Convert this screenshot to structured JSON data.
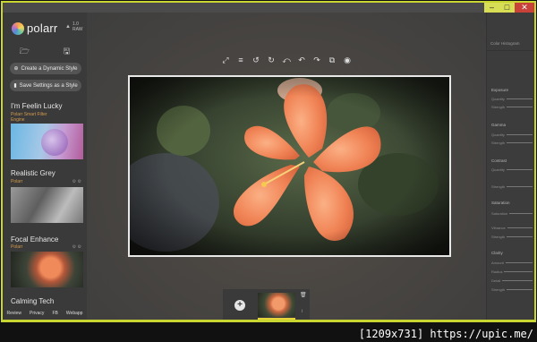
{
  "window": {
    "controls": {
      "minimize": "–",
      "maximize": "□",
      "close": "✕"
    }
  },
  "brand": {
    "name": "polarr",
    "version": "1.0 RAW"
  },
  "sidebar": {
    "file_icons": [
      "folder-open-icon",
      "save-icon"
    ],
    "create_style_label": "Create a Dynamic Style",
    "save_settings_label": "Save Settings as a Style",
    "styles": [
      {
        "title": "I'm Feelin Lucky",
        "subtitle": "Polarr Smart Filter Engine"
      },
      {
        "title": "Realistic Grey",
        "subtitle": "Polarr"
      },
      {
        "title": "Focal Enhance",
        "subtitle": "Polarr"
      },
      {
        "title": "Calming Tech",
        "subtitle": ""
      }
    ],
    "footer": [
      "Review",
      "Privacy",
      "FB",
      "Webapp"
    ]
  },
  "toolbar": {
    "icons": [
      "fit-to-screen-icon",
      "compare-icon",
      "rotate-left-icon",
      "rotate-right-icon",
      "undo-all-icon",
      "undo-icon",
      "redo-icon",
      "copy-icon",
      "preview-eye-icon"
    ],
    "glyphs": [
      "⤢",
      "≡",
      "↺",
      "↻",
      "⤺",
      "↶",
      "↷",
      "⧉",
      "◉"
    ]
  },
  "right_panel": {
    "header": "Color Histogram",
    "sections": [
      {
        "title": "Exposure",
        "rows": [
          "Quantity",
          "Strength"
        ]
      },
      {
        "title": "Gamma",
        "rows": [
          "Quantity",
          "Strength"
        ]
      },
      {
        "title": "Contrast",
        "rows": [
          "Quantity",
          "Strength"
        ]
      },
      {
        "title": "Saturation",
        "rows": [
          "Saturation",
          "Vibrance",
          "Strength"
        ]
      },
      {
        "title": "Clarity",
        "rows": [
          "Amount",
          "Radius",
          "Detail",
          "Strength"
        ]
      }
    ]
  },
  "watermark": "[1209x731] https://upic.me/"
}
